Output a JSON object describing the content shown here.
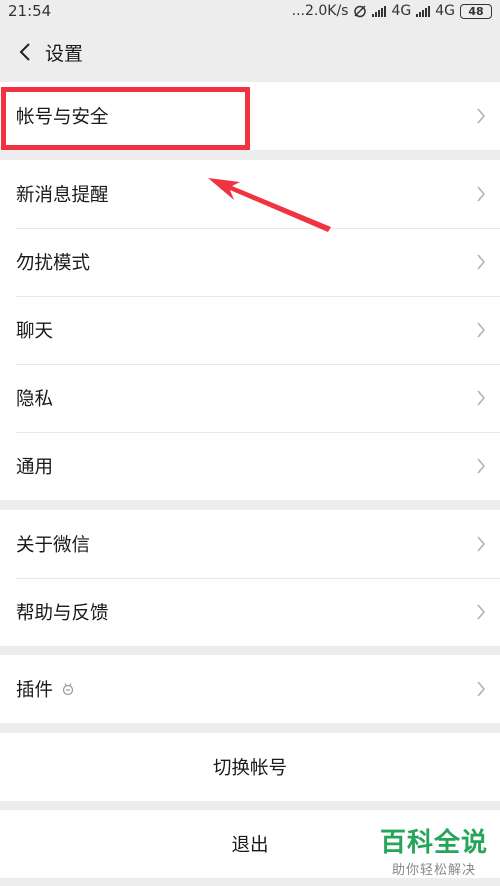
{
  "status_bar": {
    "time": "21:54",
    "net_speed": "...2.0K/s",
    "network1": "4G",
    "network2": "4G",
    "battery": "48"
  },
  "nav": {
    "title": "设置"
  },
  "groups": [
    {
      "items": [
        "帐号与安全"
      ]
    },
    {
      "items": [
        "新消息提醒",
        "勿扰模式",
        "聊天",
        "隐私",
        "通用"
      ]
    },
    {
      "items": [
        "关于微信",
        "帮助与反馈"
      ]
    },
    {
      "items": [
        "插件"
      ]
    }
  ],
  "actions": {
    "switch_account": "切换帐号",
    "logout": "退出"
  },
  "annotation_color": "#ef3340",
  "watermark": {
    "main": "百科全说",
    "sub": "助你轻松解决"
  }
}
